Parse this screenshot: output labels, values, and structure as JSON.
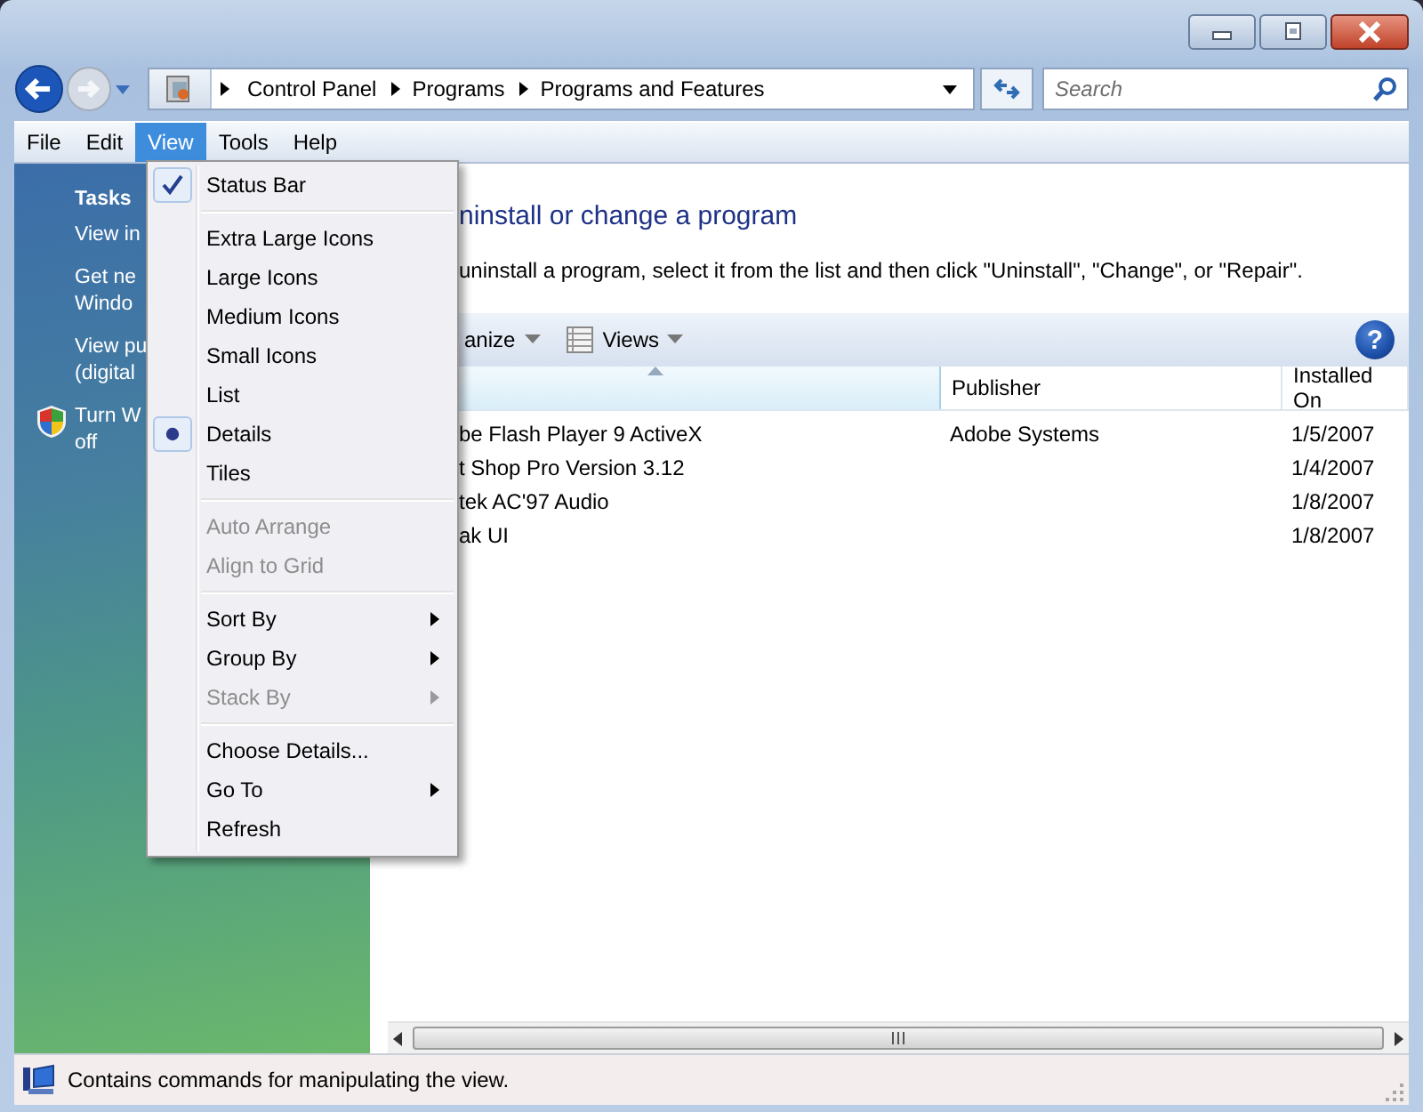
{
  "address_bar": {
    "breadcrumbs": [
      "Control Panel",
      "Programs",
      "Programs and Features"
    ]
  },
  "search": {
    "placeholder": "Search"
  },
  "menu_bar": [
    {
      "label": "File",
      "selected": false
    },
    {
      "label": "Edit",
      "selected": false
    },
    {
      "label": "View",
      "selected": true
    },
    {
      "label": "Tools",
      "selected": false
    },
    {
      "label": "Help",
      "selected": false
    }
  ],
  "sidebar": {
    "heading": "Tasks",
    "items": [
      {
        "kind": "link",
        "lines": [
          "View in"
        ]
      },
      {
        "kind": "link",
        "lines": [
          "Get ne",
          "Windo"
        ]
      },
      {
        "kind": "link",
        "lines": [
          "View pu",
          "(digital"
        ]
      },
      {
        "kind": "shield",
        "lines": [
          "Turn W",
          "off"
        ]
      }
    ]
  },
  "content": {
    "title": "ninstall or change a program",
    "description": "uninstall a program, select it from the list and then click \"Uninstall\", \"Change\", or \"Repair\".",
    "toolbar": [
      {
        "label": "anize",
        "kind": "dropdown"
      },
      {
        "label": "Views",
        "kind": "views"
      }
    ],
    "help_button": {
      "label": "?"
    },
    "table": {
      "columns": [
        {
          "label": "Publisher"
        },
        {
          "label": "Installed On"
        }
      ],
      "rows": [
        {
          "name": "be Flash Player 9 ActiveX",
          "publisher": "Adobe Systems",
          "installed_on": "1/5/2007"
        },
        {
          "name": "t Shop Pro Version 3.12",
          "installed_on": "1/4/2007"
        },
        {
          "name": "tek AC'97 Audio",
          "installed_on": "1/8/2007"
        },
        {
          "name": "ak UI",
          "installed_on": "1/8/2007"
        }
      ]
    }
  },
  "view_menu": [
    [
      {
        "label": "Status Bar",
        "kind": "check",
        "checked": true,
        "disabled": false
      }
    ],
    [
      {
        "label": "Extra Large Icons",
        "kind": "radio",
        "checked": false,
        "disabled": false
      },
      {
        "label": "Large Icons",
        "kind": "radio",
        "checked": false,
        "disabled": false
      },
      {
        "label": "Medium Icons",
        "kind": "radio",
        "checked": false,
        "disabled": false
      },
      {
        "label": "Small Icons",
        "kind": "radio",
        "checked": false,
        "disabled": false
      },
      {
        "label": "List",
        "kind": "radio",
        "checked": false,
        "disabled": false
      },
      {
        "label": "Details",
        "kind": "radio",
        "checked": true,
        "disabled": false
      },
      {
        "label": "Tiles",
        "kind": "radio",
        "checked": false,
        "disabled": false
      }
    ],
    [
      {
        "label": "Auto Arrange",
        "kind": "check",
        "checked": false,
        "disabled": true
      },
      {
        "label": "Align to Grid",
        "kind": "check",
        "checked": false,
        "disabled": true
      }
    ],
    [
      {
        "label": "Sort By",
        "kind": "submenu",
        "checked": false,
        "disabled": false
      },
      {
        "label": "Group By",
        "kind": "submenu",
        "checked": false,
        "disabled": false
      },
      {
        "label": "Stack By",
        "kind": "submenu",
        "checked": false,
        "disabled": true
      }
    ],
    [
      {
        "label": "Choose Details...",
        "kind": "command",
        "checked": false,
        "disabled": false
      },
      {
        "label": "Go To",
        "kind": "submenu",
        "checked": false,
        "disabled": false
      },
      {
        "label": "Refresh",
        "kind": "command",
        "checked": false,
        "disabled": false
      }
    ]
  ],
  "status_bar": {
    "text": "Contains commands for manipulating the view."
  }
}
